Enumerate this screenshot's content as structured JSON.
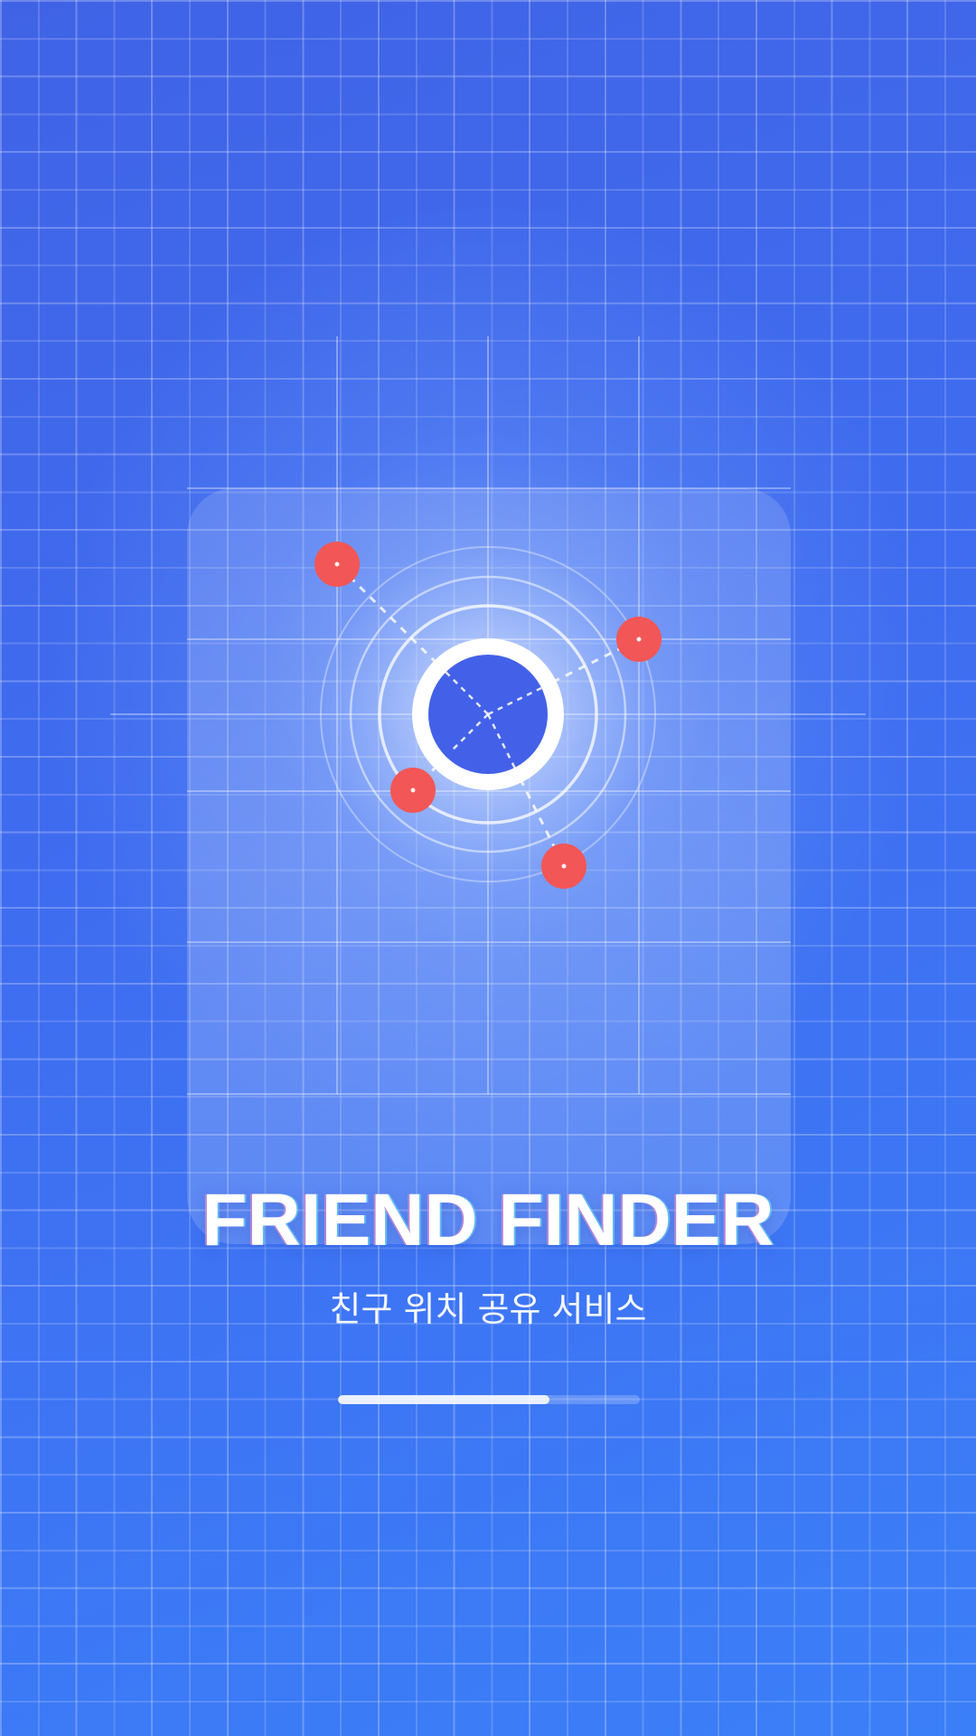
{
  "app": {
    "title": "FRIEND FINDER",
    "subtitle": "친구 위치 공유 서비스"
  },
  "loading": {
    "progress": 0.7
  },
  "colors": {
    "background_start": "#4063e6",
    "background_end": "#3b7ff8",
    "center_marker": "#4361e8",
    "friend_marker": "#f35656",
    "text": "#ffffff"
  },
  "icons": {
    "center": "my-location-icon",
    "friends": "friend-location-icon"
  },
  "friend_markers_count": 4
}
